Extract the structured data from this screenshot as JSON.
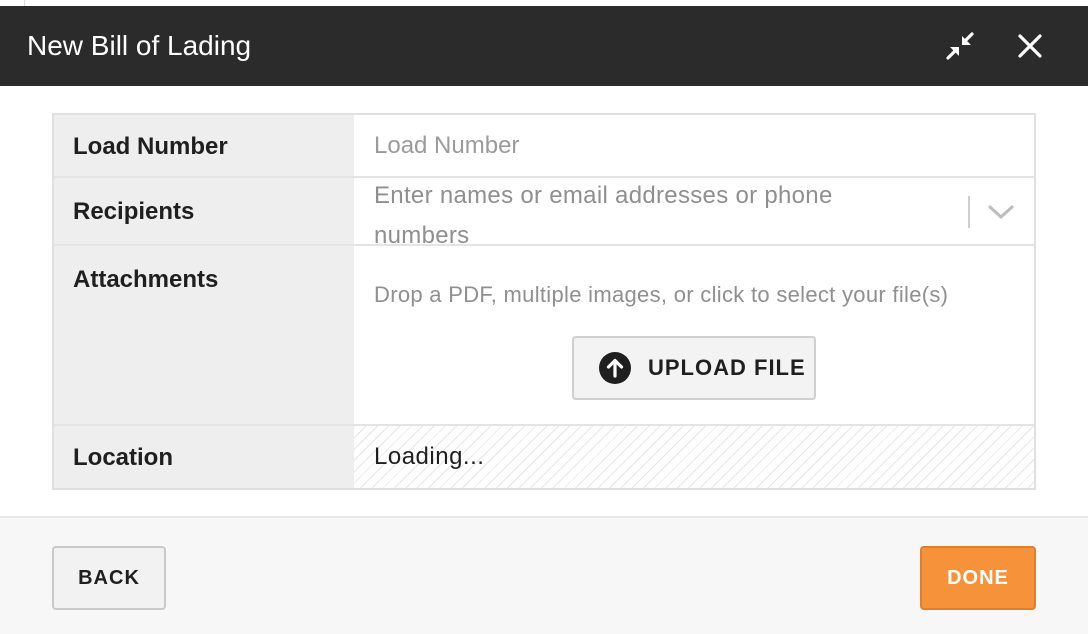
{
  "dialog": {
    "title": "New Bill of Lading",
    "collapse_icon": "collapse-arrows-icon",
    "close_icon": "close-icon"
  },
  "form": {
    "load_number": {
      "label": "Load Number",
      "placeholder": "Load Number",
      "value": ""
    },
    "recipients": {
      "label": "Recipients",
      "placeholder": "Enter names or email addresses or phone numbers",
      "dropdown_icon": "chevron-down-icon"
    },
    "attachments": {
      "label": "Attachments",
      "drop_text": "Drop a PDF, multiple images, or click to select your file(s)",
      "upload_label": "UPLOAD FILE",
      "upload_icon": "upload-arrow-circle-icon"
    },
    "location": {
      "label": "Location",
      "status": "Loading..."
    }
  },
  "footer": {
    "back_label": "BACK",
    "done_label": "DONE"
  },
  "colors": {
    "header_bg": "#2b2b2b",
    "label_bg": "#eeeeef",
    "accent": "#f6923a",
    "placeholder": "#8f8f8f"
  }
}
